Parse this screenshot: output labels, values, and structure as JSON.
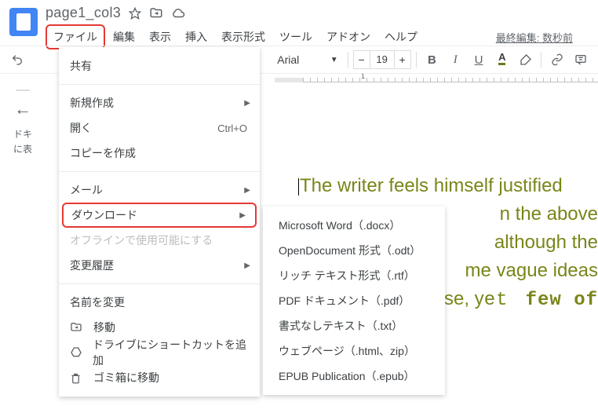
{
  "doc": {
    "title": "page1_col3"
  },
  "menus": {
    "file": "ファイル",
    "edit": "編集",
    "view": "表示",
    "insert": "挿入",
    "format": "表示形式",
    "tools": "ツール",
    "addons": "アドオン",
    "help": "ヘルプ",
    "last_edit": "最終編集: 数秒前"
  },
  "toolbar": {
    "font_name": "Arial",
    "font_size": "19"
  },
  "gutter": {
    "line1": "ドキ",
    "line2": "に表"
  },
  "file_menu": {
    "share": "共有",
    "new": "新規作成",
    "open": "開く",
    "open_shortcut": "Ctrl+O",
    "make_copy": "コピーを作成",
    "email": "メール",
    "download": "ダウンロード",
    "offline": "オフラインで使用可能にする",
    "version_history": "変更履歴",
    "rename": "名前を変更",
    "move": "移動",
    "add_shortcut": "ドライブにショートカットを追加",
    "trash": "ゴミ箱に移動"
  },
  "download_submenu": {
    "docx": "Microsoft Word（.docx）",
    "odt": "OpenDocument 形式（.odt）",
    "rtf": "リッチ テキスト形式（.rtf）",
    "pdf": "PDF ドキュメント（.pdf）",
    "txt": "書式なしテキスト（.txt）",
    "html_zip": "ウェブページ（.html、zip）",
    "epub": "EPUB Publication（.epub）"
  },
  "page_text": {
    "l1": "The writer feels himself justified",
    "l2_tail": "n the above",
    "l3_tail": " although the",
    "l4_tail": "me vague ideas",
    "l5_pre": "se, y",
    "l5_mono1": "et ",
    "l5_mono2": "few of"
  },
  "ruler": {
    "n1": "1"
  }
}
